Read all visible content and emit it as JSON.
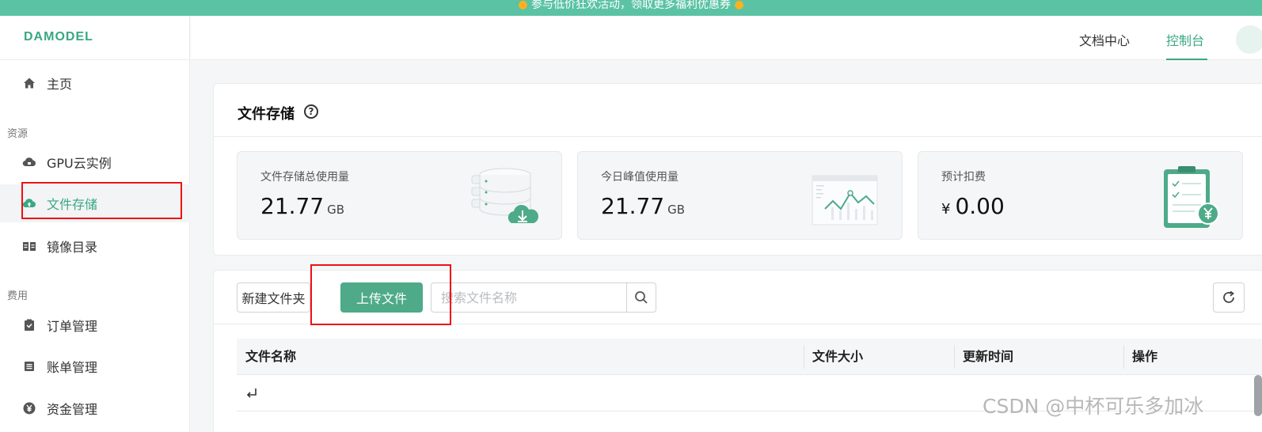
{
  "banner": {
    "text": "参与低价狂欢活动，领取更多福利优惠券"
  },
  "logo": {
    "text": "DAMODEL"
  },
  "sidebar": {
    "home": "主页",
    "section_resources": "资源",
    "resources": [
      {
        "label": "GPU云实例",
        "icon": "cloud-server-icon"
      },
      {
        "label": "文件存储",
        "icon": "cloud-upload-icon"
      },
      {
        "label": "镜像目录",
        "icon": "book-icon"
      }
    ],
    "section_fees": "费用",
    "fees": [
      {
        "label": "订单管理",
        "icon": "order-icon"
      },
      {
        "label": "账单管理",
        "icon": "bill-icon"
      },
      {
        "label": "资金管理",
        "icon": "yen-icon"
      }
    ]
  },
  "topbar": {
    "docs": "文档中心",
    "console": "控制台"
  },
  "storage": {
    "title": "文件存储",
    "stats": [
      {
        "label": "文件存储总使用量",
        "value": "21.77",
        "unit": "GB"
      },
      {
        "label": "今日峰值使用量",
        "value": "21.77",
        "unit": "GB"
      },
      {
        "label": "预计扣费",
        "currency": "¥",
        "value": "0.00"
      }
    ]
  },
  "toolbar": {
    "new_folder": "新建文件夹",
    "upload": "上传文件",
    "search_placeholder": "搜索文件名称"
  },
  "table": {
    "columns": [
      "文件名称",
      "文件大小",
      "更新时间",
      "操作"
    ]
  },
  "watermark": "CSDN @中杯可乐多加冰",
  "colors": {
    "accent": "#3aa882",
    "primary_button": "#4eaa88",
    "banner": "#5bc3a3",
    "highlight": "#ee1111"
  }
}
